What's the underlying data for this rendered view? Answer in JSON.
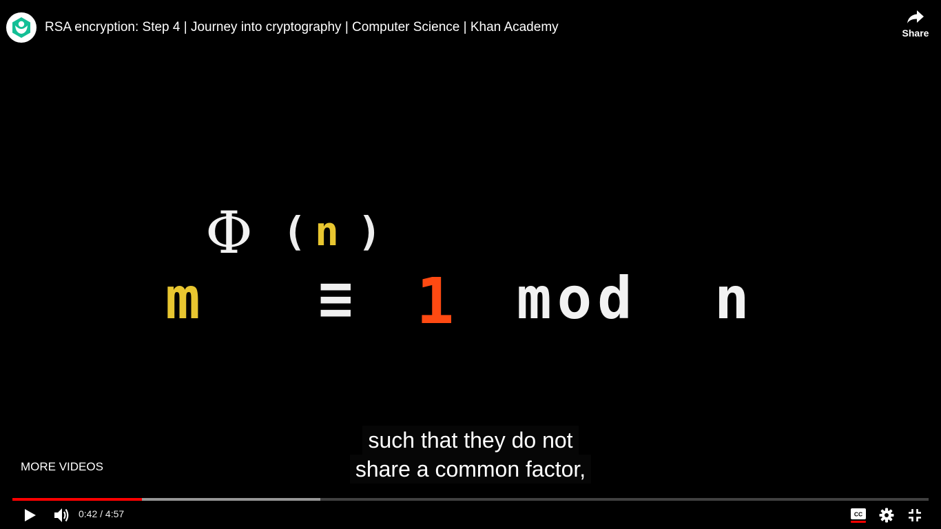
{
  "header": {
    "title": "RSA encryption: Step 4 | Journey into cryptography | Computer Science | Khan Academy",
    "share_label": "Share",
    "logo_icon": "khan-academy-logo",
    "logo_color": "#14bf96"
  },
  "video": {
    "equation": {
      "base": "m",
      "exponent_symbol": "Φ",
      "exponent_open": "(",
      "exponent_var": "n",
      "exponent_close": ")",
      "congruence": "≡",
      "remainder": "1",
      "mod_word": "mod",
      "modulus": "n"
    },
    "colors": {
      "yellow": "#e8c630",
      "orange": "#ff4a12",
      "white": "#f2f2f2"
    }
  },
  "captions": {
    "line1": "such that they do not",
    "line2": "share a common factor,"
  },
  "more_videos_label": "MORE VIDEOS",
  "player": {
    "current_time": "0:42",
    "separator": " / ",
    "duration": "4:57",
    "progress_fraction": 0.141,
    "buffer_fraction": 0.336,
    "progress_color": "#ff0000",
    "captions_enabled": true,
    "icons": [
      "play-icon",
      "volume-icon",
      "cc-icon",
      "gear-icon",
      "exit-fullscreen-icon"
    ]
  }
}
